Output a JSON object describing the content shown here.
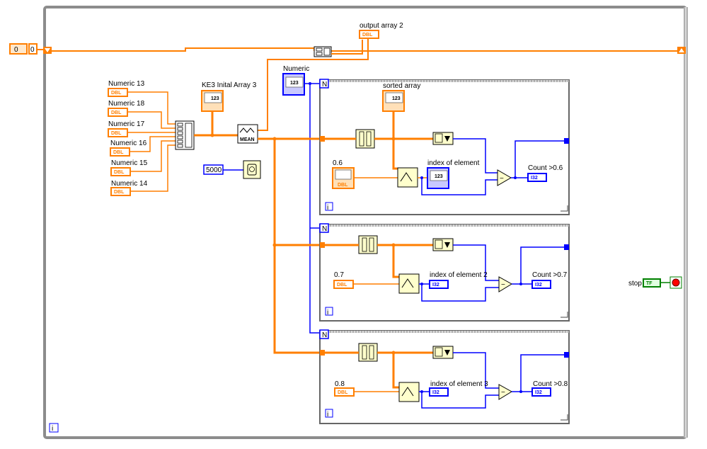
{
  "controls": {
    "numeric13": {
      "label": "Numeric 13",
      "type": "DBL"
    },
    "numeric18": {
      "label": "Numeric 18",
      "type": "DBL"
    },
    "numeric17": {
      "label": "Numeric 17",
      "type": "DBL"
    },
    "numeric16": {
      "label": "Numeric 16",
      "type": "DBL"
    },
    "numeric15": {
      "label": "Numeric 15",
      "type": "DBL"
    },
    "numeric14": {
      "label": "Numeric 14",
      "type": "DBL"
    },
    "numeric": {
      "label": "Numeric",
      "value": "123",
      "type": "I32"
    },
    "stop": {
      "label": "stop",
      "type": "TF"
    },
    "shift_register_value": "0",
    "shift_register_index": "0"
  },
  "indicators": {
    "output_array": {
      "label": "output array 2",
      "type": "DBL"
    },
    "initial_array": {
      "label": "KE3 Inital Array 3",
      "value": "123"
    },
    "sorted_array": {
      "label": "sorted array",
      "value": "123"
    },
    "index1": {
      "label": "index of element",
      "value": "123",
      "type": "I32"
    },
    "index2": {
      "label": "index of element 2",
      "type": "I32"
    },
    "index3": {
      "label": "index of element 3",
      "type": "I32"
    },
    "count1": {
      "label": "Count >0.6",
      "type": "I32"
    },
    "count2": {
      "label": "Count >0.7",
      "type": "I32"
    },
    "count3": {
      "label": "Count >0.8",
      "type": "I32"
    }
  },
  "constants": {
    "c06": {
      "label": "0.6",
      "type": "DBL"
    },
    "c07": {
      "label": "0.7",
      "type": "DBL"
    },
    "c08": {
      "label": "0.8",
      "type": "DBL"
    },
    "wait_ms": "5000"
  },
  "functions": {
    "mean": "MEAN",
    "loop_count": "N",
    "loop_iteration": "i"
  },
  "colors": {
    "wire_double": "#ff7f00",
    "wire_integer": "#0000ff",
    "loop_frame": "#8c8c8c",
    "function_fill": "#ffffcc"
  }
}
